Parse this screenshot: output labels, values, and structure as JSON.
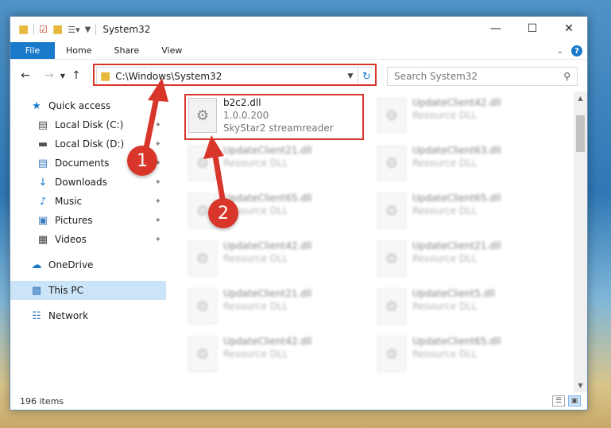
{
  "window": {
    "title": "System32"
  },
  "ribbon": {
    "tabs": [
      "File",
      "Home",
      "Share",
      "View"
    ]
  },
  "address": {
    "path": "C:\\Windows\\System32"
  },
  "search": {
    "placeholder": "Search System32"
  },
  "sidebar": {
    "items": [
      {
        "label": "Quick access",
        "icon": "star-icon"
      },
      {
        "label": "Local Disk (C:)",
        "icon": "drive-icon"
      },
      {
        "label": "Local Disk (D:)",
        "icon": "drive-icon"
      },
      {
        "label": "Documents",
        "icon": "documents-icon"
      },
      {
        "label": "Downloads",
        "icon": "downloads-icon"
      },
      {
        "label": "Music",
        "icon": "music-icon"
      },
      {
        "label": "Pictures",
        "icon": "pictures-icon"
      },
      {
        "label": "Videos",
        "icon": "videos-icon"
      },
      {
        "label": "OneDrive",
        "icon": "cloud-icon"
      },
      {
        "label": "This PC",
        "icon": "computer-icon"
      },
      {
        "label": "Network",
        "icon": "network-icon"
      }
    ]
  },
  "files": {
    "highlighted": {
      "name": "b2c2.dll",
      "version": "1.0.0.200",
      "description": "SkyStar2 streamreader"
    },
    "left_column": [
      {
        "name": "UpdateClient21.dll",
        "type": "Resource DLL"
      },
      {
        "name": "UpdateClient65.dll",
        "type": "Resource DLL"
      },
      {
        "name": "UpdateClient42.dll",
        "type": "Resource DLL"
      },
      {
        "name": "UpdateClient21.dll",
        "type": "Resource DLL"
      },
      {
        "name": "UpdateClient42.dll",
        "type": "Resource DLL"
      }
    ],
    "right_column": [
      {
        "name": "UpdateClient42.dll",
        "type": "Resource DLL"
      },
      {
        "name": "UpdateClient63.dll",
        "type": "Resource DLL"
      },
      {
        "name": "UpdateClient65.dll",
        "type": "Resource DLL"
      },
      {
        "name": "UpdateClient21.dll",
        "type": "Resource DLL"
      },
      {
        "name": "UpdateClient5.dll",
        "type": "Resource DLL"
      },
      {
        "name": "UpdateClient65.dll",
        "type": "Resource DLL"
      }
    ]
  },
  "status": {
    "count": "196 items"
  },
  "callouts": [
    "1",
    "2"
  ],
  "colors": {
    "accent": "#1979ca",
    "highlight": "#d9362b",
    "selected": "#cce4f7"
  }
}
